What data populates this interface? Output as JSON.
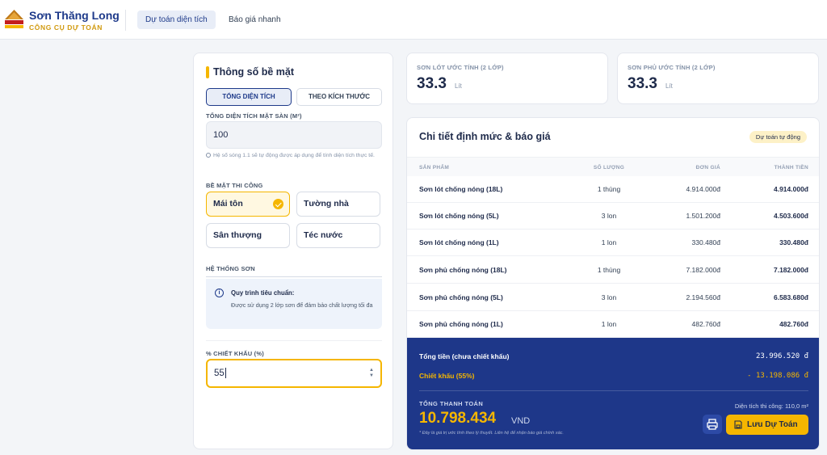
{
  "brand": {
    "logo_text": "SƠN THĂNG LONG",
    "name": "Sơn Thăng Long",
    "tagline": "CÔNG CỤ DỰ TOÁN"
  },
  "nav": {
    "tabs": [
      {
        "label": "Dự toán diện tích",
        "active": true
      },
      {
        "label": "Báo giá nhanh",
        "active": false
      }
    ]
  },
  "form": {
    "title": "Thông số bề mặt",
    "mode_tabs": [
      "TỔNG DIỆN TÍCH",
      "THEO KÍCH THƯỚC"
    ],
    "area_label": "TỔNG DIỆN TÍCH MẶT SÀN (M²)",
    "area_value": "100",
    "area_note": "Hệ số sóng 1.1 sẽ tự động được áp dụng để tính diện tích thực tế.",
    "surface_label": "BỀ MẶT THI CÔNG",
    "surfaces": [
      "Mái tôn",
      "Tường nhà",
      "Sân thượng",
      "Téc nước"
    ],
    "selected_surface": "Mái tôn",
    "system_label": "HỆ THỐNG SƠN",
    "system_info_title": "Quy trình tiêu chuẩn:",
    "system_info_text": "Được sử dụng 2 lớp sơn để đảm bảo chất lượng tối đa",
    "discount_label": "% CHIẾT KHẤU (%)",
    "discount_value": "55"
  },
  "stats": [
    {
      "label": "SƠN LÓT ƯỚC TÍNH (2 LỚP)",
      "value": "33.3",
      "unit": "Lít"
    },
    {
      "label": "SƠN PHỦ ƯỚC TÍNH (2 LỚP)",
      "value": "33.3",
      "unit": "Lít"
    }
  ],
  "quote": {
    "title": "Chi tiết định mức & báo giá",
    "badge": "Dự toán tự động",
    "columns": [
      "SẢN PHẨM",
      "SỐ LƯỢNG",
      "ĐƠN GIÁ",
      "THÀNH TIỀN"
    ],
    "rows": [
      {
        "name": "Sơn lót chống nóng (18L)",
        "qty": "1 thùng",
        "price": "4.914.000đ",
        "total": "4.914.000đ"
      },
      {
        "name": "Sơn lót chống nóng (5L)",
        "qty": "3 lon",
        "price": "1.501.200đ",
        "total": "4.503.600đ"
      },
      {
        "name": "Sơn lót chống nóng (1L)",
        "qty": "1 lon",
        "price": "330.480đ",
        "total": "330.480đ"
      },
      {
        "name": "Sơn phủ chống nóng (18L)",
        "qty": "1 thùng",
        "price": "7.182.000đ",
        "total": "7.182.000đ"
      },
      {
        "name": "Sơn phủ chống nóng (5L)",
        "qty": "3 lon",
        "price": "2.194.560đ",
        "total": "6.583.680đ"
      },
      {
        "name": "Sơn phủ chống nóng (1L)",
        "qty": "1 lon",
        "price": "482.760đ",
        "total": "482.760đ"
      }
    ],
    "subtotal_label": "Tổng tiền (chưa chiết khấu)",
    "subtotal_value": "23.996.520 đ",
    "discount_label": "Chiết khấu (55%)",
    "discount_value": "- 13.198.086 đ",
    "grand_label": "TỔNG THANH TOÁN",
    "grand_value": "10.798.434",
    "grand_unit": "VND",
    "disclaimer": "* Đây là giá trị ước tính theo lý thuyết. Liên hệ để nhận báo giá chính xác.",
    "area_text": "Diện tích thi công: 110,0 m²",
    "save_label": "Lưu Dự Toán"
  },
  "colors": {
    "navy": "#1e3789",
    "gold": "#f5b600",
    "background": "#f3f5f8"
  },
  "icons": [
    "logo-icon",
    "info-icon",
    "check-icon",
    "print-icon",
    "save-icon",
    "spinner-icon"
  ]
}
